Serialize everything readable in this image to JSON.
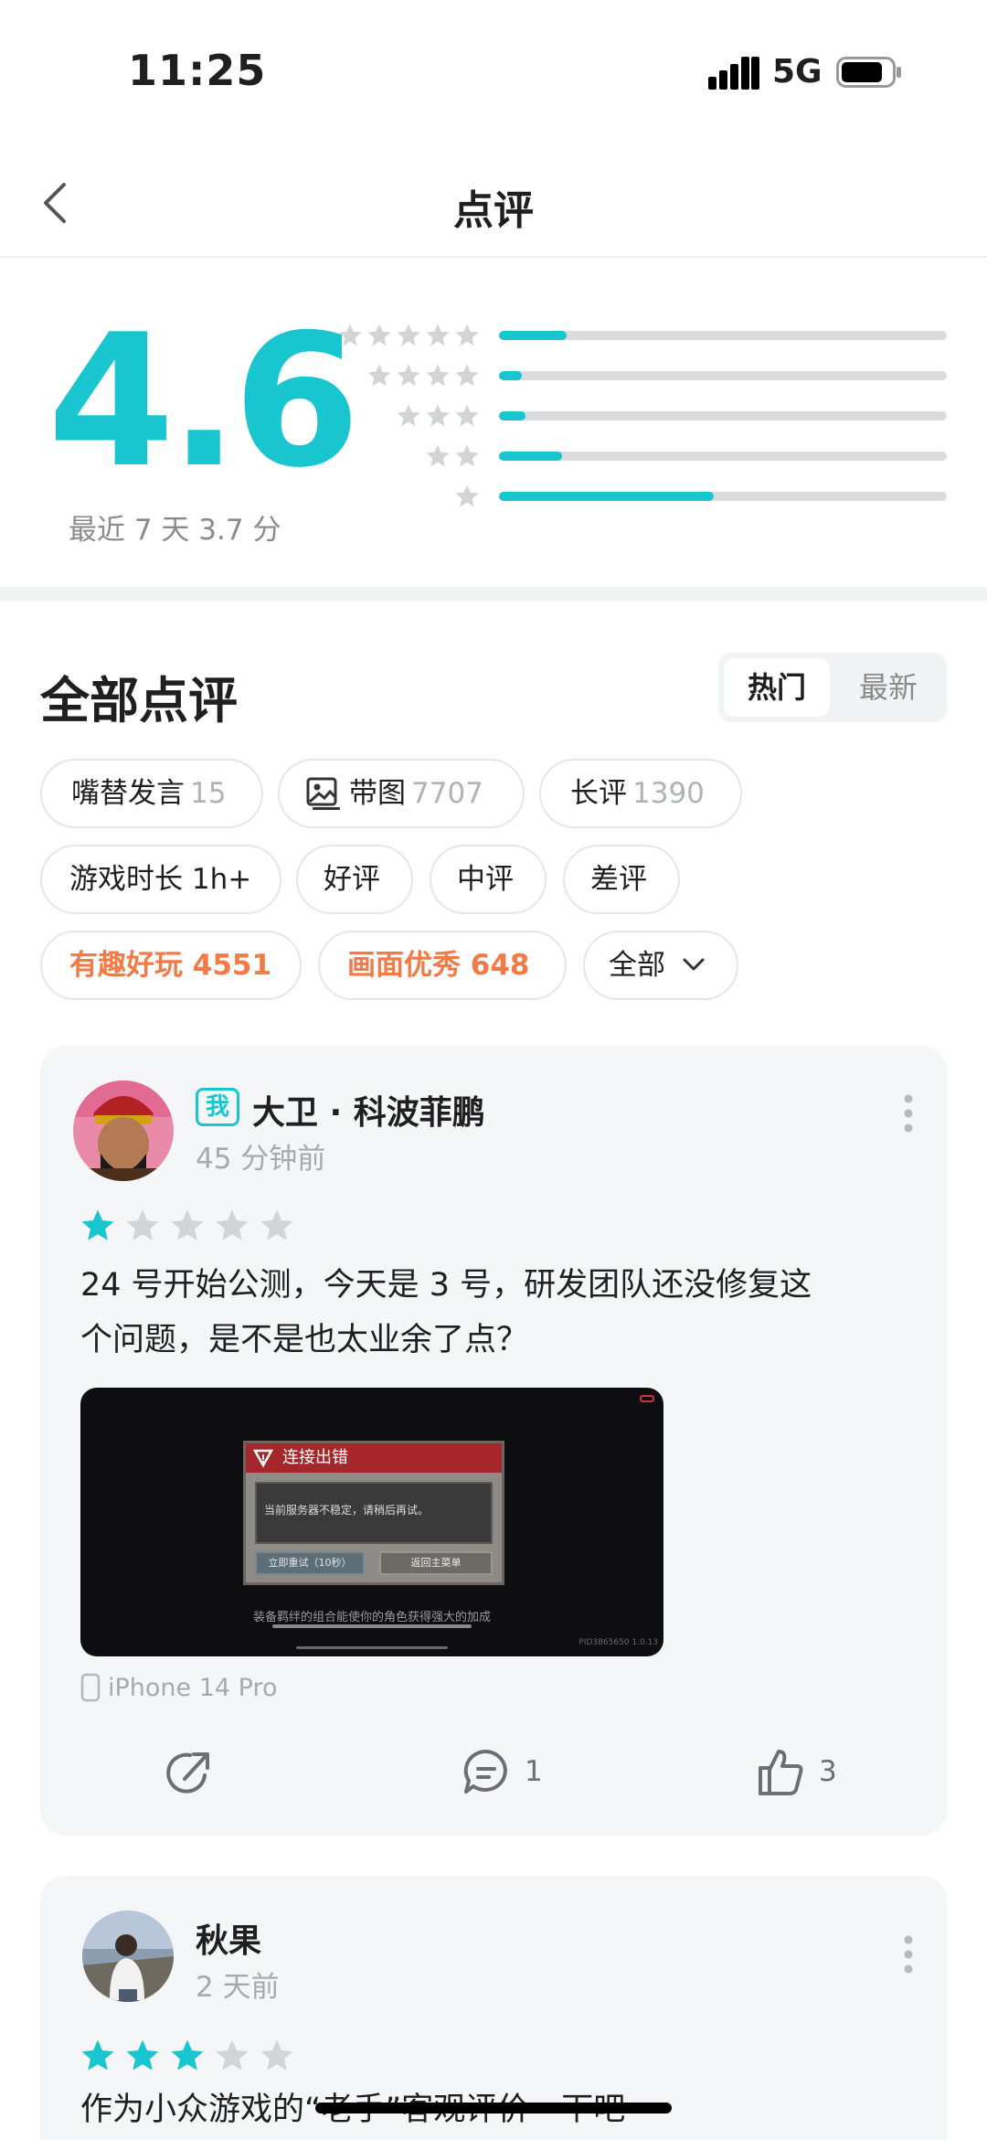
{
  "status_bar": {
    "time": "11:25",
    "network": "5G"
  },
  "nav": {
    "title": "点评"
  },
  "rating": {
    "score": "4.6",
    "recent": "最近 7 天 3.7 分",
    "distribution": [
      {
        "stars": 5,
        "fraction": 0.15
      },
      {
        "stars": 4,
        "fraction": 0.05
      },
      {
        "stars": 3,
        "fraction": 0.06
      },
      {
        "stars": 2,
        "fraction": 0.14
      },
      {
        "stars": 1,
        "fraction": 0.48
      }
    ]
  },
  "reviews_header": {
    "title": "全部点评",
    "sort_hot": "热门",
    "sort_new": "最新"
  },
  "filters": {
    "row1": [
      {
        "label": "嘴替发言",
        "count": "15"
      },
      {
        "label": "带图",
        "count": "7707"
      },
      {
        "label": "长评",
        "count": "1390"
      }
    ],
    "row2": [
      {
        "label": "游戏时长 1h+"
      },
      {
        "label": "好评"
      },
      {
        "label": "中评"
      },
      {
        "label": "差评"
      }
    ],
    "row3": [
      {
        "label": "有趣好玩 4551"
      },
      {
        "label": "画面优秀 648"
      },
      {
        "label": "全部"
      }
    ]
  },
  "reviews": [
    {
      "badge": "我",
      "user": "大卫 · 科波菲鹏",
      "time": "45 分钟前",
      "rating": 1,
      "text_line1": "24 号开始公测，今天是 3 号，研发团队还没修复这",
      "text_line2": "个问题，是不是也太业余了点？",
      "screenshot": {
        "dialog_title": "连接出错",
        "dialog_message": "当前服务器不稳定，请稍后再试。",
        "btn_retry": "立即重试（10秒）",
        "btn_menu": "返回主菜单",
        "tip": "装备羁绊的组合能使你的角色获得强大的加成",
        "pid": "PID3865650 1.0.13"
      },
      "device": "iPhone 14 Pro",
      "comments": "1",
      "likes": "3"
    },
    {
      "user": "秋果",
      "time": "2 天前",
      "rating": 3,
      "text_line1": "作为小众游戏的“老手”客观评价一下吧"
    }
  ],
  "colors": {
    "accent": "#19c6cf",
    "highlight": "#f47a45",
    "card_bg": "#f5f6f8"
  }
}
